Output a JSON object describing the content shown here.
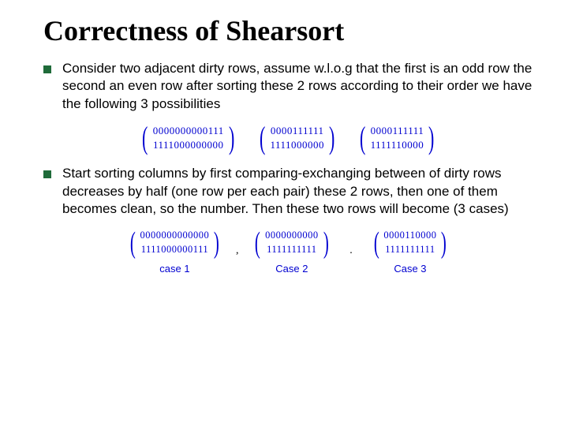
{
  "title": "Correctness of Shearsort",
  "paragraphs": {
    "p1": "Consider two adjacent dirty rows, assume w.l.o.g that the first is an odd row the second an even row after sorting these 2 rows according to their order we have the following 3 possibilities",
    "p2": "Start sorting columns by first comparing-exchanging between of dirty rows decreases by half (one row per each pair) these 2 rows, then one of them becomes clean, so the number. Then these two rows will become (3 cases)"
  },
  "figure1": {
    "m1": {
      "r1": "0000000000111",
      "r2": "1111000000000"
    },
    "m2": {
      "r1": "0000111111",
      "r2": "1111000000"
    },
    "m3": {
      "r1": "0000111111",
      "r2": "1111110000"
    }
  },
  "figure2": {
    "c1": {
      "r1": "0000000000000",
      "r2": "1111000000111",
      "label": "case 1"
    },
    "c2": {
      "r1": "0000000000",
      "r2": "1111111111",
      "label": "Case 2"
    },
    "c3": {
      "r1": "0000110000",
      "r2": "1111111111",
      "label": "Case 3"
    }
  }
}
